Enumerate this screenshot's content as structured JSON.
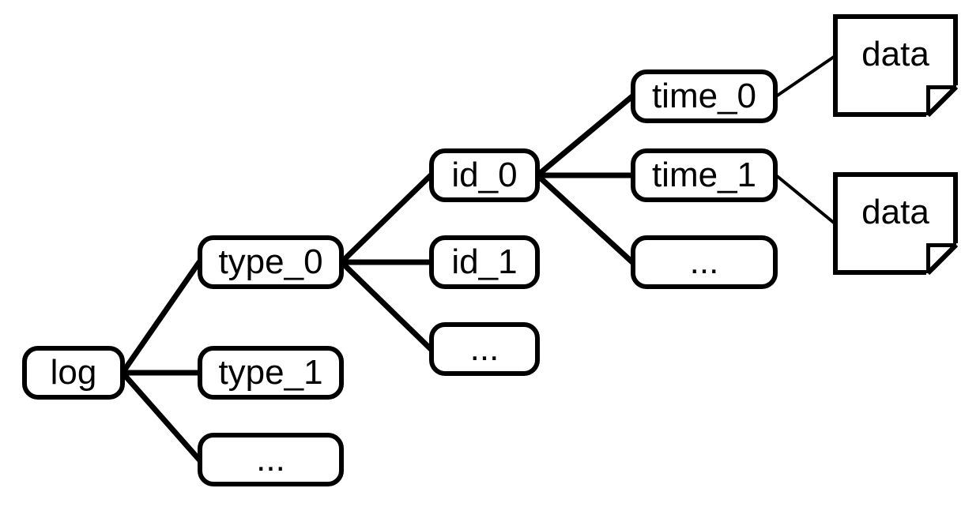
{
  "nodes": {
    "root": "log",
    "level1": {
      "n0": "type_0",
      "n1": "type_1",
      "n2": "..."
    },
    "level2": {
      "n0": "id_0",
      "n1": "id_1",
      "n2": "..."
    },
    "level3": {
      "n0": "time_0",
      "n1": "time_1",
      "n2": "..."
    },
    "leaf": {
      "d0": "data",
      "d1": "data"
    }
  },
  "chart_data": {
    "type": "tree",
    "root": {
      "label": "log",
      "children": [
        {
          "label": "type_0",
          "children": [
            {
              "label": "id_0",
              "children": [
                {
                  "label": "time_0",
                  "children": [
                    {
                      "label": "data",
                      "kind": "file"
                    }
                  ]
                },
                {
                  "label": "time_1",
                  "children": [
                    {
                      "label": "data",
                      "kind": "file"
                    }
                  ]
                },
                {
                  "label": "..."
                }
              ]
            },
            {
              "label": "id_1"
            },
            {
              "label": "..."
            }
          ]
        },
        {
          "label": "type_1"
        },
        {
          "label": "..."
        }
      ]
    }
  }
}
